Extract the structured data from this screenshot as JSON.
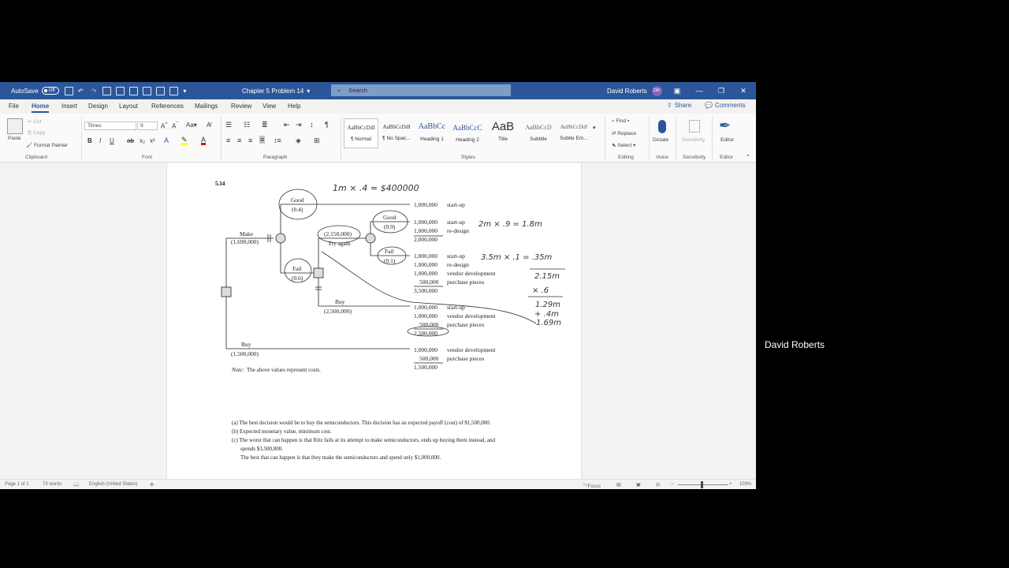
{
  "title_bar": {
    "autosave_label": "AutoSave",
    "autosave_state": "Off",
    "doc_title": "Chapter 5 Problem 14",
    "search_placeholder": "Search",
    "user_name": "David Roberts",
    "user_initials": "DR",
    "brand_color": "#2b579a"
  },
  "menu": {
    "tabs": [
      "File",
      "Home",
      "Insert",
      "Design",
      "Layout",
      "References",
      "Mailings",
      "Review",
      "View",
      "Help"
    ],
    "active_tab": "Home",
    "share_label": "Share",
    "comments_label": "Comments"
  },
  "ribbon": {
    "clipboard": {
      "paste": "Paste",
      "cut": "Cut",
      "copy": "Copy",
      "format_painter": "Format Painter",
      "label": "Clipboard"
    },
    "font": {
      "name": "Times",
      "size": "9",
      "label": "Font"
    },
    "paragraph": {
      "label": "Paragraph"
    },
    "styles": {
      "label": "Styles",
      "items": [
        {
          "sample": "AaBbCcDdI",
          "name": "¶ Normal"
        },
        {
          "sample": "AaBbCcDdI",
          "name": "¶ No Spac..."
        },
        {
          "sample": "AaBbCc",
          "name": "Heading 1"
        },
        {
          "sample": "AaBbCcC",
          "name": "Heading 2"
        },
        {
          "sample": "AaB",
          "name": "Title"
        },
        {
          "sample": "AaBbCcD",
          "name": "Subtitle"
        },
        {
          "sample": "AaBbCcDdI",
          "name": "Subtle Em..."
        }
      ]
    },
    "editing": {
      "find": "Find",
      "replace": "Replace",
      "select": "Select",
      "label": "Editing"
    },
    "voice": {
      "dictate": "Dictate",
      "label": "Voice"
    },
    "sensitivity": {
      "button": "Sensitivity",
      "label": "Sensitivity"
    },
    "editor": {
      "button": "Editor",
      "label": "Editor"
    }
  },
  "document": {
    "problem_number": "5.14",
    "tree": {
      "make_label": "Make",
      "make_value": "(1,690,000)",
      "buy_label": "Buy",
      "buy_value": "(1,500,000)",
      "good_label": "Good",
      "good_prob": "(0.4)",
      "fail_label": "Fail",
      "fail_prob": "(0.6)",
      "try_again_value": "(2,150,000)",
      "try_again_label": "Try again",
      "good2_label": "Good",
      "good2_prob": "(0.9)",
      "fail2_label": "Fail",
      "fail2_prob": "(0.1)",
      "buy2_label": "Buy",
      "buy2_value": "(2,500,000)"
    },
    "outcomes": [
      {
        "lines": [
          [
            "1,000,000",
            "start-up"
          ]
        ],
        "total": ""
      },
      {
        "lines": [
          [
            "1,000,000",
            "start-up"
          ],
          [
            "1,000,000",
            "re-design"
          ]
        ],
        "total": "2,000,000"
      },
      {
        "lines": [
          [
            "1,000,000",
            "start-up"
          ],
          [
            "1,000,000",
            "re-design"
          ],
          [
            "1,000,000",
            "vendor development"
          ],
          [
            "500,000",
            "purchase pieces"
          ]
        ],
        "total": "3,500,000"
      },
      {
        "lines": [
          [
            "1,000,000",
            "start-up"
          ],
          [
            "1,000,000",
            "vendor development"
          ],
          [
            "500,000",
            "purchase pieces"
          ]
        ],
        "total": "2,500,000"
      },
      {
        "lines": [
          [
            "1,000,000",
            "vendor development"
          ],
          [
            "500,000",
            "purchase pieces"
          ]
        ],
        "total": "1,500,000"
      }
    ],
    "note_prefix": "Note:",
    "note_text": "The above values represent costs.",
    "answers": [
      "(a) The best decision would be to buy the semiconductors. This decision has an expected payoff (cost) of $1,500,000.",
      "(b) Expected monetary value, minimum cost.",
      "(c) The worst that can happen is that Ritz fails at its attempt to make semiconductors, ends up buying them instead, and",
      "spends $3,500,000.",
      "The best that can happen is that they make the semiconductors and spend only $1,000,000."
    ],
    "handwriting": {
      "top": "1m × .4 = $400000",
      "right1": "2m × .9 = 1.8m",
      "right2": "3.5m × .1 = .35m",
      "sum1": "2.15m",
      "mult": "× .6",
      "sum2": "1.29m",
      "add": "+ .4m",
      "result": "1.69m"
    }
  },
  "status_bar": {
    "page": "Page 1 of 1",
    "words": "73 words",
    "language": "English (United States)",
    "focus": "Focus",
    "zoom": "103%"
  },
  "participant": {
    "name": "David Roberts"
  }
}
